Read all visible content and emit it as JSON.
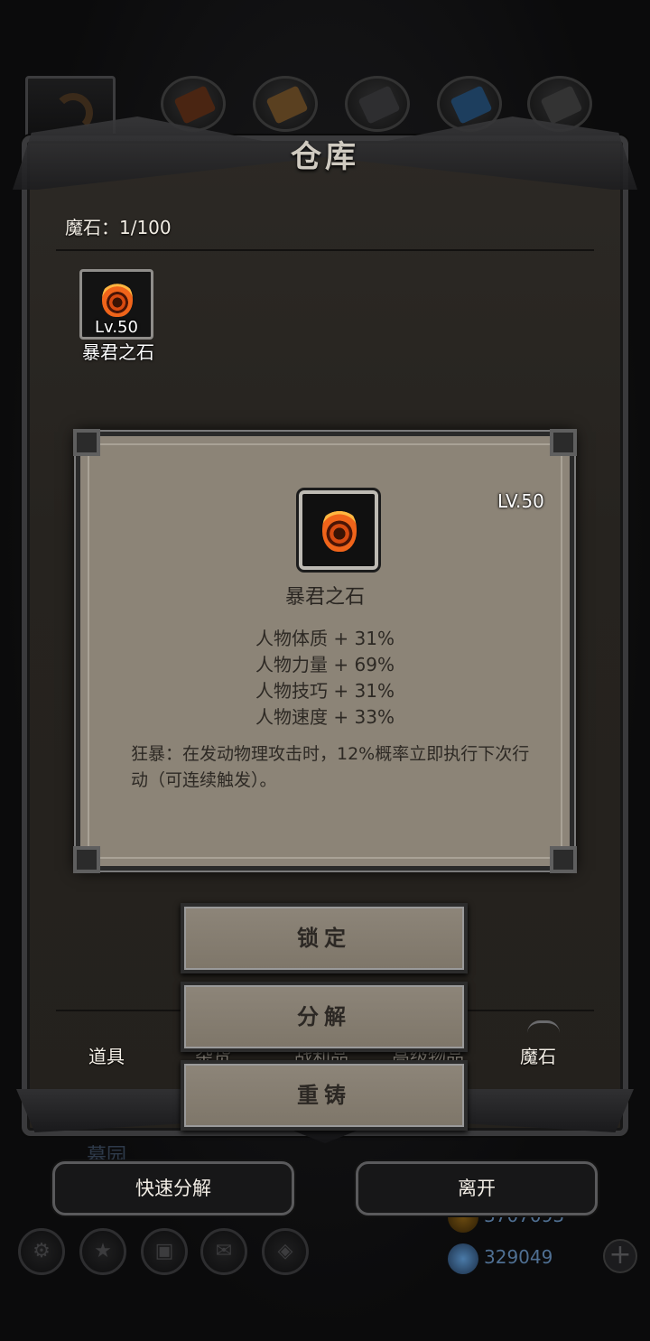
{
  "window": {
    "title": "仓库"
  },
  "inventory": {
    "count_label": "魔石：1/100",
    "items": [
      {
        "name": "暴君之石",
        "level": "Lv.50",
        "icon": "flame-stone-icon"
      }
    ]
  },
  "detail": {
    "level": "LV.50",
    "name": "暴君之石",
    "icon": "flame-stone-icon",
    "stats": [
      "人物体质 + 31%",
      "人物力量 + 69%",
      "人物技巧 + 31%",
      "人物速度 + 33%"
    ],
    "description": "狂暴：在发动物理攻击时，12%概率立即执行下次行动（可连续触发）。"
  },
  "actions": {
    "lock": "锁定",
    "decompose": "分解",
    "reforge": "重铸"
  },
  "tabs": [
    {
      "label": "道具",
      "active": false
    },
    {
      "label": "杂货",
      "active": false
    },
    {
      "label": "战利品",
      "active": false
    },
    {
      "label": "高级物品",
      "active": false
    },
    {
      "label": "魔石",
      "active": true
    }
  ],
  "bottom": {
    "quick_decompose": "快速分解",
    "leave": "离开",
    "place": "墓园"
  },
  "currency": {
    "gold": "3707093",
    "gems": "329049"
  },
  "colors": {
    "panel": "#27241f",
    "popup": "#8c8477",
    "text_dark": "#2d2924",
    "flame": "#f0641a"
  }
}
